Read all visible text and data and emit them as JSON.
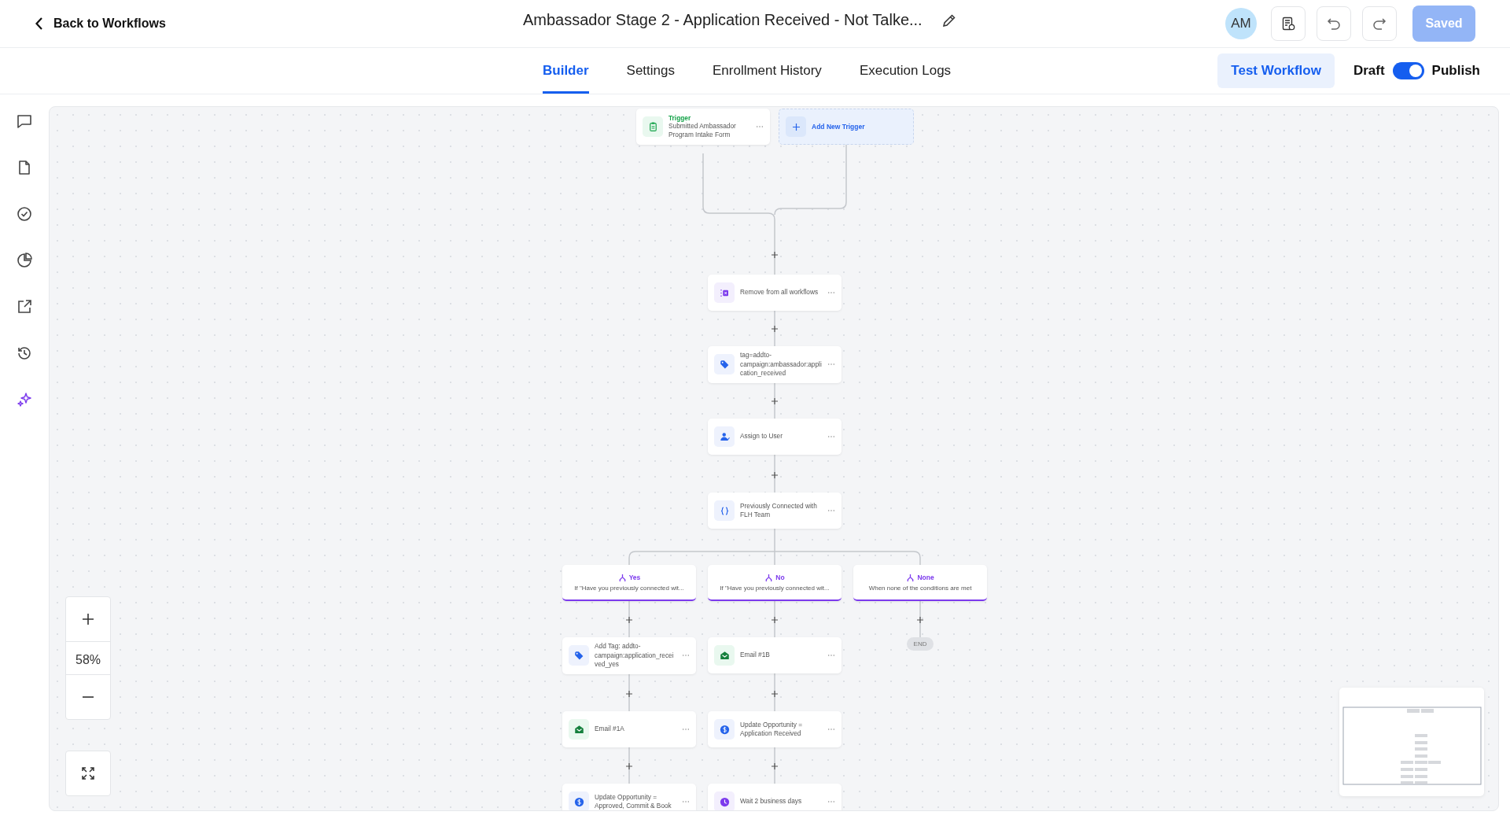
{
  "header": {
    "back_label": "Back to Workflows",
    "title": "Ambassador Stage 2 - Application Received - Not Talke...",
    "avatar": "AM",
    "saved_button": "Saved"
  },
  "tabs": [
    {
      "label": "Builder",
      "selected": true
    },
    {
      "label": "Settings",
      "selected": false
    },
    {
      "label": "Enrollment History",
      "selected": false
    },
    {
      "label": "Execution Logs",
      "selected": false
    }
  ],
  "test_button": "Test Workflow",
  "publish": {
    "off_label": "Draft",
    "on_label": "Publish",
    "on": true
  },
  "canvas": {
    "triggers": [
      {
        "kind": "trigger",
        "heading": "Trigger",
        "label": "Submitted Ambassador Program Intake Form"
      },
      {
        "kind": "add",
        "label": "Add New Trigger"
      }
    ],
    "steps": [
      {
        "kind": "remove",
        "label": "Remove from all workflows"
      },
      {
        "kind": "tag",
        "label": "tag=addto-campaign:ambassador:application_received"
      },
      {
        "kind": "assign",
        "label": "Assign to User"
      },
      {
        "kind": "condition",
        "label": "Previously Connected with FLH Team"
      }
    ],
    "branches": [
      {
        "name": "Yes",
        "condition": "If \"Have you previously connected wit...",
        "steps": [
          {
            "kind": "tag",
            "label": "Add Tag: addto-campaign:application_received_yes"
          },
          {
            "kind": "email",
            "label": "Email #1A"
          },
          {
            "kind": "opportunity",
            "label": "Update Opportunity = Approved, Commit & Book"
          }
        ]
      },
      {
        "name": "No",
        "condition": "If \"Have you previously connected wit...",
        "steps": [
          {
            "kind": "email",
            "label": "Email #1B"
          },
          {
            "kind": "opportunity",
            "label": "Update Opportunity = Application Received"
          },
          {
            "kind": "wait",
            "label": "Wait 2 business days"
          }
        ]
      },
      {
        "name": "None",
        "condition": "When none of the conditions are met",
        "end": "END"
      }
    ]
  },
  "zoom": {
    "level_label": "58%"
  }
}
